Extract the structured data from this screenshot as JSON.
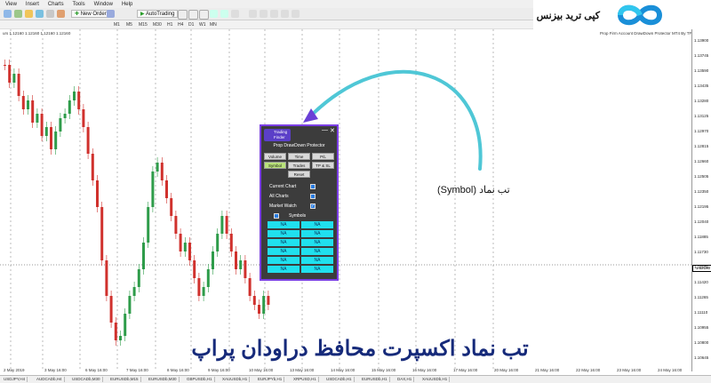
{
  "menu": [
    "View",
    "Insert",
    "Charts",
    "Tools",
    "Window",
    "Help"
  ],
  "toolbar": {
    "new_order": "New Order",
    "autotrading": "AutoTrading"
  },
  "timeframes": [
    "M1",
    "M5",
    "M15",
    "M30",
    "H1",
    "H4",
    "D1",
    "W1",
    "MN"
  ],
  "header_text": "urs 1.12160 1.12160 1.12160 1.12160",
  "indicator_text": "Prop Firm Account DrawDown Protector MT4 By TFlab",
  "prices": [
    "1.13900",
    "1.13745",
    "1.13590",
    "1.13435",
    "1.13280",
    "1.13125",
    "1.12970",
    "1.12815",
    "1.12660",
    "1.12505",
    "1.12350",
    "1.12195",
    "1.12040",
    "1.11885",
    "1.11730",
    "1.11575",
    "1.11420",
    "1.11265",
    "1.11110",
    "1.10955",
    "1.10800",
    "1.10645"
  ],
  "current_price": "1.12160",
  "dates": [
    "2 May 2019",
    "3 May 16:00",
    "6 May 16:00",
    "7 May 16:00",
    "8 May 16:00",
    "9 May 16:00",
    "10 May 16:00",
    "13 May 16:00",
    "14 May 16:00",
    "15 May 16:00",
    "16 May 16:00",
    "17 May 16:00",
    "20 May 16:00",
    "21 May 16:00",
    "22 May 16:00",
    "23 May 16:00",
    "24 May 16:00"
  ],
  "symbol_tabs": [
    "USDJPY,H4",
    "AUDCADb,H4",
    "USDCADb,M30",
    "EURUSDb,M15",
    "EURUSDb,M30",
    "GBPUSDb,H1",
    "XAUUSDb,H1",
    "EURJPYb,H1",
    "XRPUSD,H1",
    "USDCADb,H1",
    "EURUSDb,H1",
    "DAX,H1",
    "XAUUSDb,H1"
  ],
  "logo_text": "کپی ترید بیزنس",
  "panel": {
    "brand_line1": "Trading",
    "brand_line2": "Finder",
    "title": "Prop DrawDown Protector",
    "tabs": [
      [
        "Volume",
        "Time",
        "P/L"
      ],
      [
        "Symbol",
        "Trades",
        "TP & SL"
      ],
      [
        "",
        "Reset",
        ""
      ]
    ],
    "options": [
      "Current Chart",
      "All Charts",
      "Market Watch"
    ],
    "symbols_label": "Symbols",
    "grid": [
      "NA",
      "NA",
      "NA",
      "NA",
      "NA",
      "NA",
      "NA",
      "NA",
      "NA",
      "NA",
      "NA",
      "NA"
    ]
  },
  "callout_text": "تب نماد (Symbol)",
  "page_title": "تب نماد اکسپرت محافظ دراودان پراپ",
  "colors": {
    "accent": "#7b3fe4",
    "cyan": "#20e0ee",
    "title": "#162a7a",
    "arrow": "#4fc7d6"
  }
}
